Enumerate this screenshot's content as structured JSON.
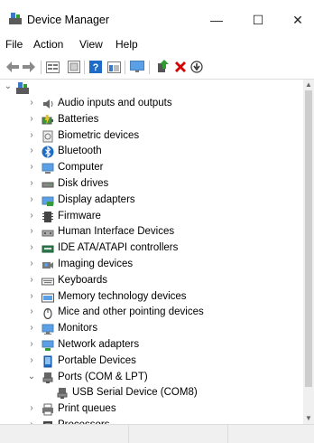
{
  "window": {
    "title": "Device Manager",
    "minimize": "—",
    "maximize": "☐",
    "close": "✕"
  },
  "menu": [
    "File",
    "Action",
    "View",
    "Help"
  ],
  "toolbar": [
    "back-icon",
    "forward-icon",
    "properties-icon",
    "show-hidden-icon",
    "help-icon",
    "action-pane-icon",
    "monitor-icon",
    "update-driver-icon",
    "uninstall-icon",
    "scan-hardware-icon"
  ],
  "tree": {
    "root_label": "",
    "categories": [
      {
        "label": "Audio inputs and outputs",
        "icon": "speaker-icon",
        "expanded": false
      },
      {
        "label": "Batteries",
        "icon": "battery-icon",
        "expanded": false
      },
      {
        "label": "Biometric devices",
        "icon": "biometric-icon",
        "expanded": false
      },
      {
        "label": "Bluetooth",
        "icon": "bluetooth-icon",
        "expanded": false
      },
      {
        "label": "Computer",
        "icon": "computer-icon",
        "expanded": false
      },
      {
        "label": "Disk drives",
        "icon": "disk-drive-icon",
        "expanded": false
      },
      {
        "label": "Display adapters",
        "icon": "display-adapter-icon",
        "expanded": false
      },
      {
        "label": "Firmware",
        "icon": "firmware-icon",
        "expanded": false
      },
      {
        "label": "Human Interface Devices",
        "icon": "hid-icon",
        "expanded": false
      },
      {
        "label": "IDE ATA/ATAPI controllers",
        "icon": "ide-controller-icon",
        "expanded": false
      },
      {
        "label": "Imaging devices",
        "icon": "camera-icon",
        "expanded": false
      },
      {
        "label": "Keyboards",
        "icon": "keyboard-icon",
        "expanded": false
      },
      {
        "label": "Memory technology devices",
        "icon": "memory-icon",
        "expanded": false
      },
      {
        "label": "Mice and other pointing devices",
        "icon": "mouse-icon",
        "expanded": false
      },
      {
        "label": "Monitors",
        "icon": "monitor-icon",
        "expanded": false
      },
      {
        "label": "Network adapters",
        "icon": "network-icon",
        "expanded": false
      },
      {
        "label": "Portable Devices",
        "icon": "portable-device-icon",
        "expanded": false
      },
      {
        "label": "Ports (COM & LPT)",
        "icon": "port-icon",
        "expanded": true,
        "children": [
          {
            "label": "USB Serial Device (COM8)",
            "icon": "port-icon"
          }
        ]
      },
      {
        "label": "Print queues",
        "icon": "printer-icon",
        "expanded": false
      },
      {
        "label": "Processors",
        "icon": "processor-icon",
        "expanded": false
      }
    ]
  },
  "colors": {
    "accent": "#0078d7",
    "uninstall": "#d40000",
    "update": "#2e9e2e"
  }
}
